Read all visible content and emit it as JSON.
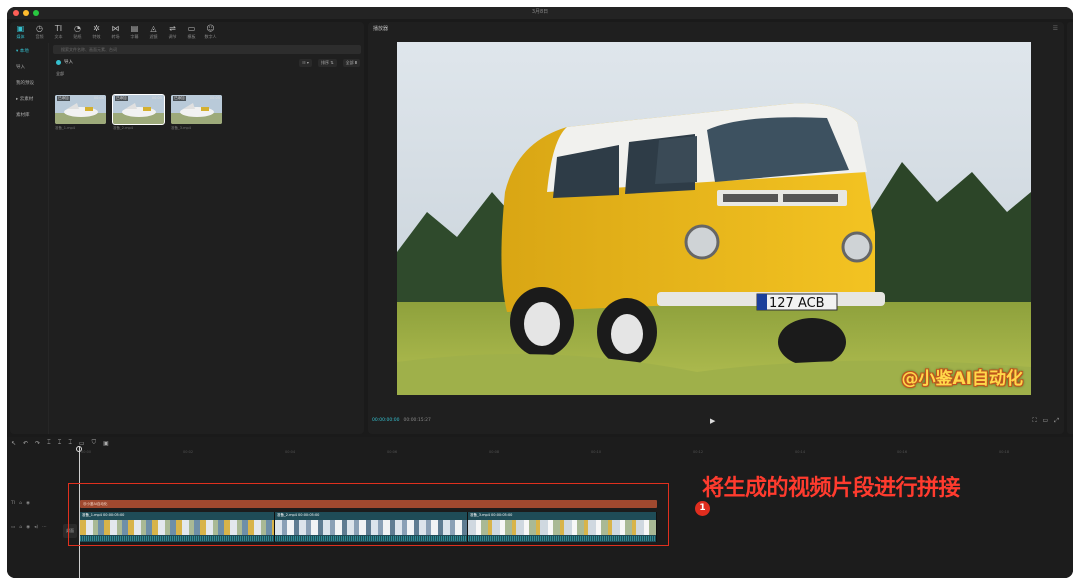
{
  "window": {
    "title": "3月8日",
    "dots": [
      "#ff5f57",
      "#febc2e",
      "#28c840"
    ]
  },
  "toolbar": [
    {
      "label": "媒体",
      "icon": "▣",
      "name": "media-icon",
      "active": true
    },
    {
      "label": "音频",
      "icon": "◷",
      "name": "audio-icon"
    },
    {
      "label": "文本",
      "icon": "TI",
      "name": "text-icon"
    },
    {
      "label": "贴纸",
      "icon": "◔",
      "name": "sticker-icon"
    },
    {
      "label": "特效",
      "icon": "✲",
      "name": "effects-icon"
    },
    {
      "label": "转场",
      "icon": "⋈",
      "name": "transition-icon"
    },
    {
      "label": "字幕",
      "icon": "▤",
      "name": "subtitle-icon"
    },
    {
      "label": "滤镜",
      "icon": "◬",
      "name": "filter-icon"
    },
    {
      "label": "调节",
      "icon": "⇌",
      "name": "adjust-icon"
    },
    {
      "label": "模板",
      "icon": "▭",
      "name": "template-icon"
    },
    {
      "label": "数字人",
      "icon": "☺",
      "name": "digital-human-icon"
    }
  ],
  "sidebar": [
    {
      "label": "▾ 本地",
      "active": true
    },
    {
      "label": "导入"
    },
    {
      "label": "我的预设"
    },
    {
      "label": "▸ 云素材"
    },
    {
      "label": "素材库"
    }
  ],
  "media": {
    "search_placeholder": "搜索文件名称、画面元素、台词",
    "import_label": "导入",
    "sort_buttons": [
      "☷ ▾",
      "排序 ⇅",
      "全部 ⩩"
    ],
    "all_label": "全部",
    "items": [
      {
        "badge": "已添加",
        "duration": "00:05",
        "name": "准备_1.mp4"
      },
      {
        "badge": "已添加",
        "duration": "00:05",
        "name": "准备_2.mp4",
        "selected": true
      },
      {
        "badge": "已添加",
        "duration": "00:05",
        "name": "准备_3.mp4"
      }
    ]
  },
  "player": {
    "title": "播放器",
    "current_time": "00:00:00:00",
    "total_time": "00:00:15:27",
    "watermark": "@小鉴AI自动化",
    "plate": "127 ACB"
  },
  "timeline": {
    "toolbar_icons": [
      "↖",
      "↶",
      "↷",
      "⌶",
      "⌶",
      "⌶",
      "▭",
      "⛉",
      "▣"
    ],
    "ticks": [
      "00:00",
      "00:02",
      "00:04",
      "00:06",
      "00:08",
      "00:10",
      "00:12",
      "00:14",
      "00:16",
      "00:18",
      "00:20"
    ],
    "cover_label": "封面",
    "text_clip_label": "@小鉴AI自动化",
    "clips": [
      {
        "label": "准备_1.mp4  00:00:05:00",
        "width": 195
      },
      {
        "label": "准备_2.mp4  00:00:05:00",
        "width": 193
      },
      {
        "label": "准备_3.mp4  00:00:05:00",
        "width": 189
      }
    ]
  },
  "annotation": {
    "text": "将生成的视频片段进行拼接",
    "badge": "1"
  }
}
